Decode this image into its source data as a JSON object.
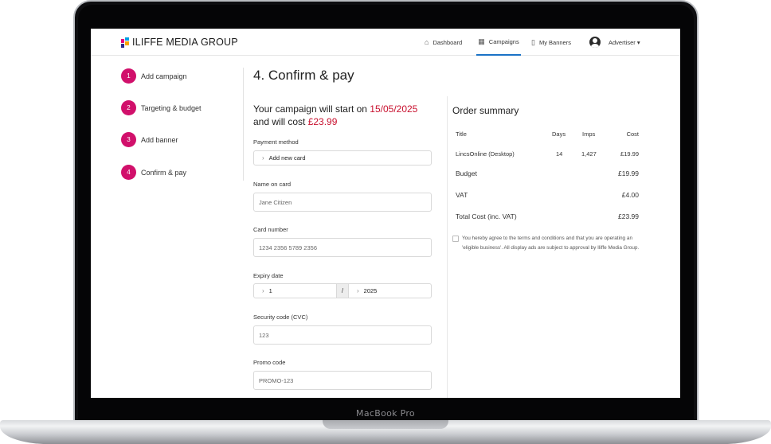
{
  "device": {
    "model": "MacBook Pro"
  },
  "nav": {
    "brand": "ILIFFE MEDIA GROUP",
    "items": [
      {
        "label": "Dashboard",
        "icon": "home-icon"
      },
      {
        "label": "Campaigns",
        "icon": "calendar-icon",
        "active": true
      },
      {
        "label": "My Banners",
        "icon": "bookmark-icon"
      }
    ],
    "account_label": "Advertiser ▾"
  },
  "steps": [
    {
      "number": "1",
      "label": "Add campaign"
    },
    {
      "number": "2",
      "label": "Targeting & budget"
    },
    {
      "number": "3",
      "label": "Add banner"
    },
    {
      "number": "4",
      "label": "Confirm & pay"
    }
  ],
  "form": {
    "title": "4. Confirm & pay",
    "headline_prefix": "Your campaign will start on ",
    "start_date": "15/05/2025",
    "headline_mid": "and will cost ",
    "cost": "£23.99",
    "payment_method_label": "Payment method",
    "payment_method_value": "Add new card",
    "name_label": "Name on card",
    "name_placeholder": "Jane Citizen",
    "card_label": "Card number",
    "card_placeholder": "1234 2356 5789 2356",
    "expiry_label": "Expiry date",
    "expiry_month": "1",
    "expiry_sep": "/",
    "expiry_year": "2025",
    "cvc_label": "Security code (CVC)",
    "cvc_placeholder": "123",
    "promo_label": "Promo code",
    "promo_placeholder": "PROMO-123"
  },
  "summary": {
    "title": "Order summary",
    "headers": {
      "title": "Title",
      "days": "Days",
      "imps": "Imps",
      "cost": "Cost"
    },
    "line": {
      "title": "LincsOnline (Desktop)",
      "days": "14",
      "imps": "1,427",
      "cost": "£19.99"
    },
    "budget_label": "Budget",
    "budget_value": "£19.99",
    "vat_label": "VAT",
    "vat_value": "£4.00",
    "total_label": "Total Cost (inc. VAT)",
    "total_value": "£23.99",
    "terms": "You hereby agree to the terms and conditions and that you are operating an 'eligible business'. All display ads are subject to approval by Iliffe Media Group."
  },
  "colors": {
    "accent": "#d1106b",
    "highlight": "#c8102e",
    "active_tab": "#1a73c6"
  }
}
